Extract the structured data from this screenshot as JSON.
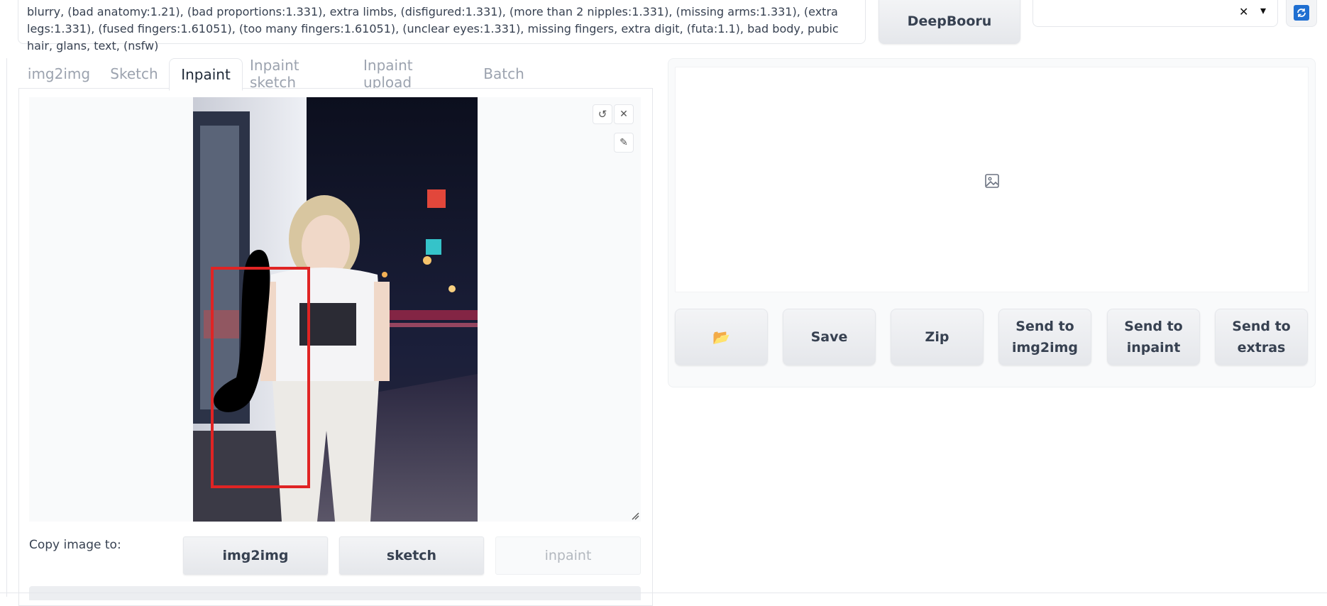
{
  "prompt": {
    "negative_text": "blurry, (bad anatomy:1.21), (bad proportions:1.331), extra limbs, (disfigured:1.331), (more than 2 nipples:1.331), (missing arms:1.331), (extra legs:1.331), (fused fingers:1.61051), (too many fingers:1.61051), (unclear eyes:1.331), missing fingers, extra digit, (futa:1.1), bad body, pubic hair, glans, text, (nsfw)"
  },
  "interrogate": {
    "deepbooru_label": "DeepBooru"
  },
  "style_select": {
    "value": "",
    "clear_glyph": "✕",
    "dropdown_glyph": "▾"
  },
  "tabs": [
    {
      "label": "img2img"
    },
    {
      "label": "Sketch"
    },
    {
      "label": "Inpaint"
    },
    {
      "label": "Inpaint sketch"
    },
    {
      "label": "Inpaint upload"
    },
    {
      "label": "Batch"
    }
  ],
  "active_tab": "Inpaint",
  "canvas": {
    "undo_glyph": "↺",
    "close_glyph": "✕",
    "brush_glyph": "✎"
  },
  "copy_to": {
    "label": "Copy image to:",
    "buttons": [
      "img2img",
      "sketch",
      "inpaint"
    ]
  },
  "output_actions": {
    "folder_glyph": "📂",
    "save": "Save",
    "zip": "Zip",
    "send_img2img": [
      "Send to",
      "img2img"
    ],
    "send_inpaint": [
      "Send to",
      "inpaint"
    ],
    "send_extras": [
      "Send to",
      "extras"
    ]
  },
  "colors": {
    "mask_rect": "#e02424",
    "refresh_accent": "#1f6fd1",
    "panel_bg": "#f9fafb"
  }
}
